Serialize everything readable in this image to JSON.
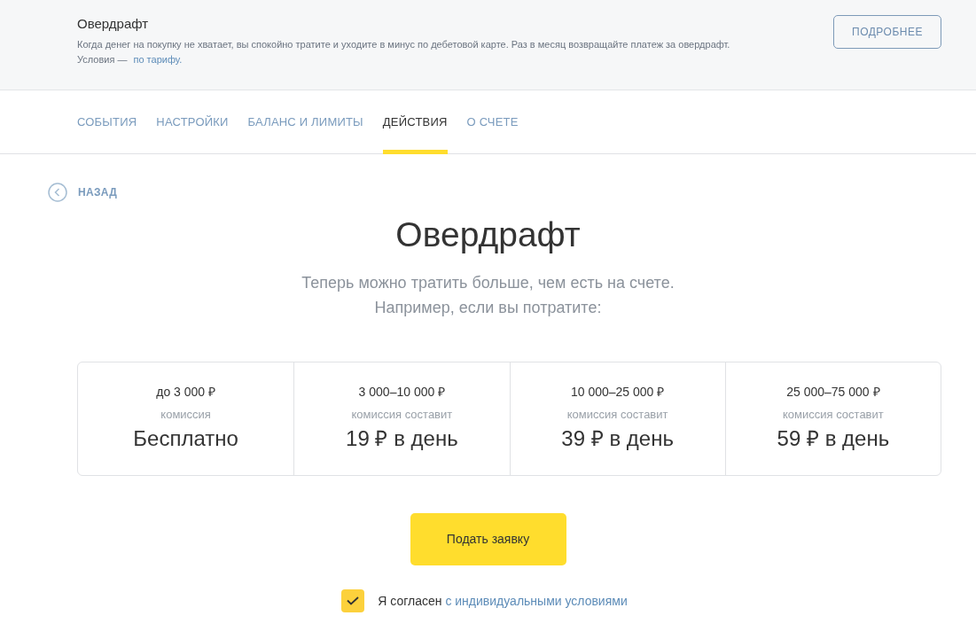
{
  "banner": {
    "title": "Овердрафт",
    "description": "Когда денег на покупку не хватает, вы спокойно тратите и уходите в минус по дебетовой карте. Раз в месяц возвращайте платеж за овердрафт.",
    "conditions_prefix": "Условия — ",
    "conditions_link": "по тарифу.",
    "button": "ПОДРОБНЕЕ"
  },
  "tabs": [
    {
      "label": "СОБЫТИЯ",
      "selected": false
    },
    {
      "label": "НАСТРОЙКИ",
      "selected": false
    },
    {
      "label": "БАЛАНС И ЛИМИТЫ",
      "selected": false
    },
    {
      "label": "ДЕЙСТВИЯ",
      "selected": true
    },
    {
      "label": "О СЧЕТЕ",
      "selected": false
    }
  ],
  "back": "НАЗАД",
  "title": "Овердрафт",
  "subtitle": [
    "Теперь можно тратить больше, чем есть на счете.",
    "Например, если вы потратите:"
  ],
  "tiers": [
    {
      "range": "до 3 000 ₽",
      "caption": "комиссия",
      "fee": "Бесплатно"
    },
    {
      "range": "3 000–10 000 ₽",
      "caption": "комиссия составит",
      "fee": "19 ₽ в день"
    },
    {
      "range": "10 000–25 000 ₽",
      "caption": "комиссия составит",
      "fee": "39 ₽ в день"
    },
    {
      "range": "25 000–75 000 ₽",
      "caption": "комиссия составит",
      "fee": "59 ₽ в день"
    }
  ],
  "apply_button": "Подать заявку",
  "agreement": {
    "checked": true,
    "text": "Я согласен",
    "link": "с индивидуальными условиями"
  }
}
